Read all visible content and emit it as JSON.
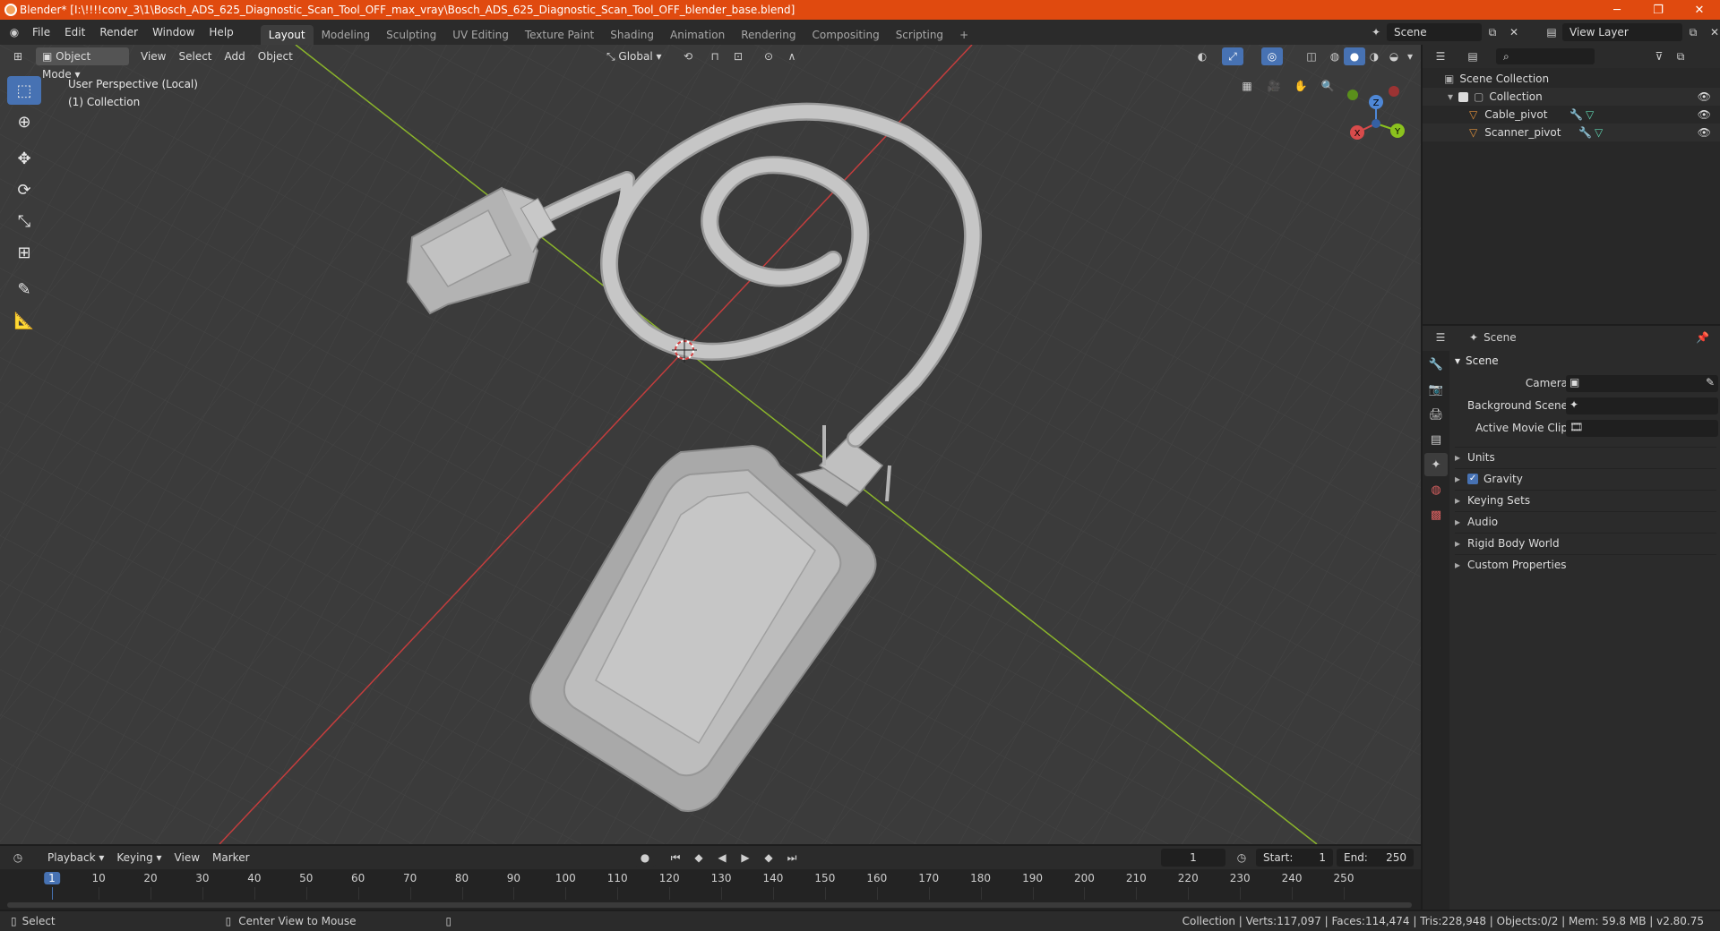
{
  "window": {
    "title": "Blender* [I:\\!!!!conv_3\\1\\Bosch_ADS_625_Diagnostic_Scan_Tool_OFF_max_vray\\Bosch_ADS_625_Diagnostic_Scan_Tool_OFF_blender_base.blend]",
    "minimize": "─",
    "maximize": "❐",
    "close": "✕"
  },
  "menu": [
    "File",
    "Edit",
    "Render",
    "Window",
    "Help"
  ],
  "workspaces": [
    "Layout",
    "Modeling",
    "Sculpting",
    "UV Editing",
    "Texture Paint",
    "Shading",
    "Animation",
    "Rendering",
    "Compositing",
    "Scripting"
  ],
  "workspace_add": "+",
  "scene_selector": "Scene",
  "view_layer": "View Layer",
  "viewport": {
    "mode": "Object Mode",
    "menus": [
      "View",
      "Select",
      "Add",
      "Object"
    ],
    "orientation": "Global",
    "perspective_label": "User Perspective (Local)",
    "collection_label": "(1) Collection",
    "gizmo": {
      "x": "X",
      "y": "Y",
      "z": "Z"
    }
  },
  "outliner": {
    "search_placeholder": "",
    "scene_collection": "Scene Collection",
    "collection": "Collection",
    "items": [
      "Cable_pivot",
      "Scanner_pivot"
    ]
  },
  "properties": {
    "header": "Scene",
    "panel": "Scene",
    "camera_label": "Camera",
    "background_scene_label": "Background Scene",
    "active_clip_label": "Active Movie Clip",
    "sections": [
      "Units",
      "Gravity",
      "Keying Sets",
      "Audio",
      "Rigid Body World",
      "Custom Properties"
    ]
  },
  "timeline": {
    "menus": [
      "Playback",
      "Keying",
      "View",
      "Marker"
    ],
    "current_frame": "1",
    "start_label": "Start:",
    "start": "1",
    "end_label": "End:",
    "end": "250",
    "ticks": [
      "1",
      "10",
      "20",
      "30",
      "40",
      "50",
      "60",
      "70",
      "80",
      "90",
      "100",
      "110",
      "120",
      "130",
      "140",
      "150",
      "160",
      "170",
      "180",
      "190",
      "200",
      "210",
      "220",
      "230",
      "240",
      "250"
    ]
  },
  "status": {
    "left": "Select",
    "middle": "Center View to Mouse",
    "right": "Collection | Verts:117,097 | Faces:114,474 | Tris:228,948 | Objects:0/2 | Mem: 59.8 MB | v2.80.75"
  },
  "colors": {
    "title_bar": "#e04a0f",
    "accent": "#4772b3",
    "viewport_bg": "#3b3b3b",
    "axis_x": "#c43d3d",
    "axis_y": "#8bb52b",
    "object_orange": "#e0913b"
  }
}
